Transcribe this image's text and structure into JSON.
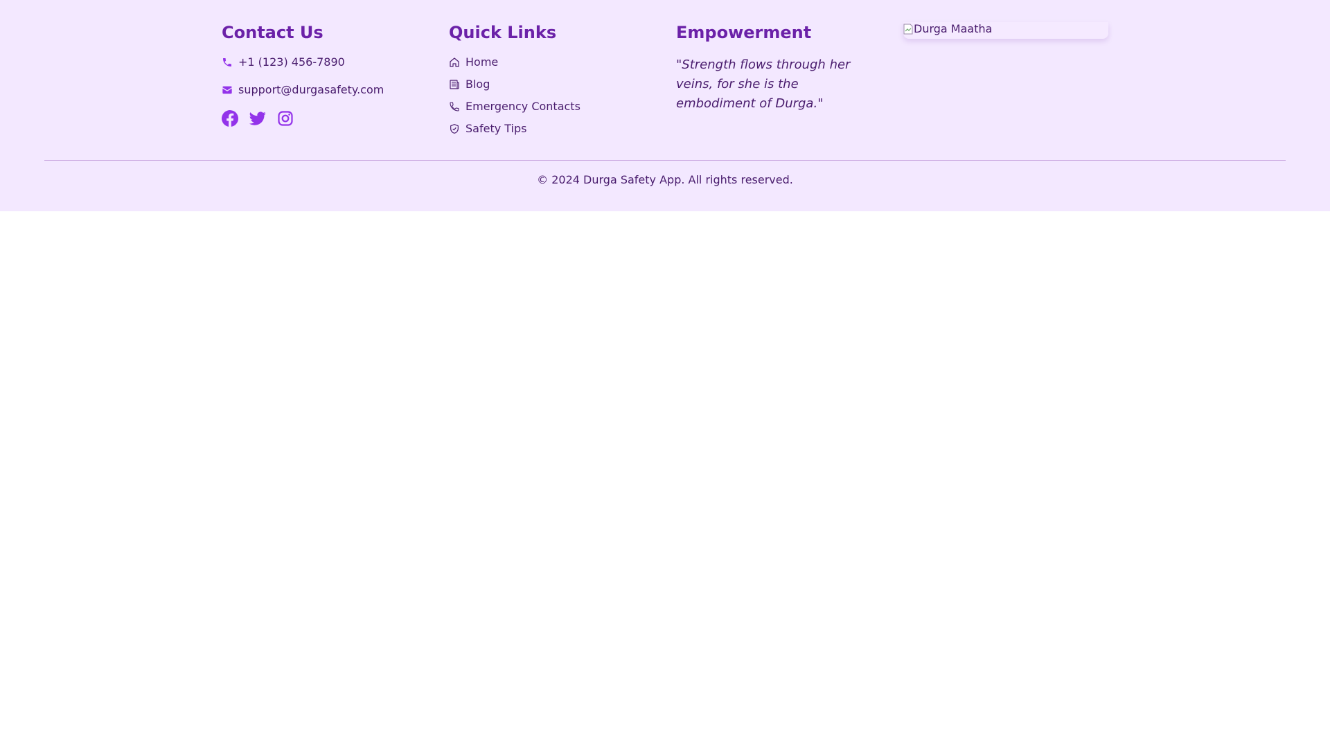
{
  "contact": {
    "heading": "Contact Us",
    "phone": "+1 (123) 456-7890",
    "email": "support@durgasafety.com",
    "socials": [
      "facebook-icon",
      "twitter-icon",
      "instagram-icon"
    ]
  },
  "quick_links": {
    "heading": "Quick Links",
    "items": [
      {
        "label": "Home",
        "icon": "home-icon"
      },
      {
        "label": "Blog",
        "icon": "blog-icon"
      },
      {
        "label": "Emergency Contacts",
        "icon": "phone-outline-icon"
      },
      {
        "label": "Safety Tips",
        "icon": "shield-icon"
      }
    ]
  },
  "empowerment": {
    "heading": "Empowerment",
    "quote": "\"Strength flows through her veins, for she is the embodiment of Durga.\""
  },
  "image": {
    "alt": "Durga Maatha"
  },
  "footer": {
    "copyright": "© 2024 Durga Safety App. All rights reserved."
  },
  "colors": {
    "background": "#f3e8ff",
    "heading": "#6b21a8",
    "text": "#4a1d6e",
    "accent": "#9333ea"
  }
}
